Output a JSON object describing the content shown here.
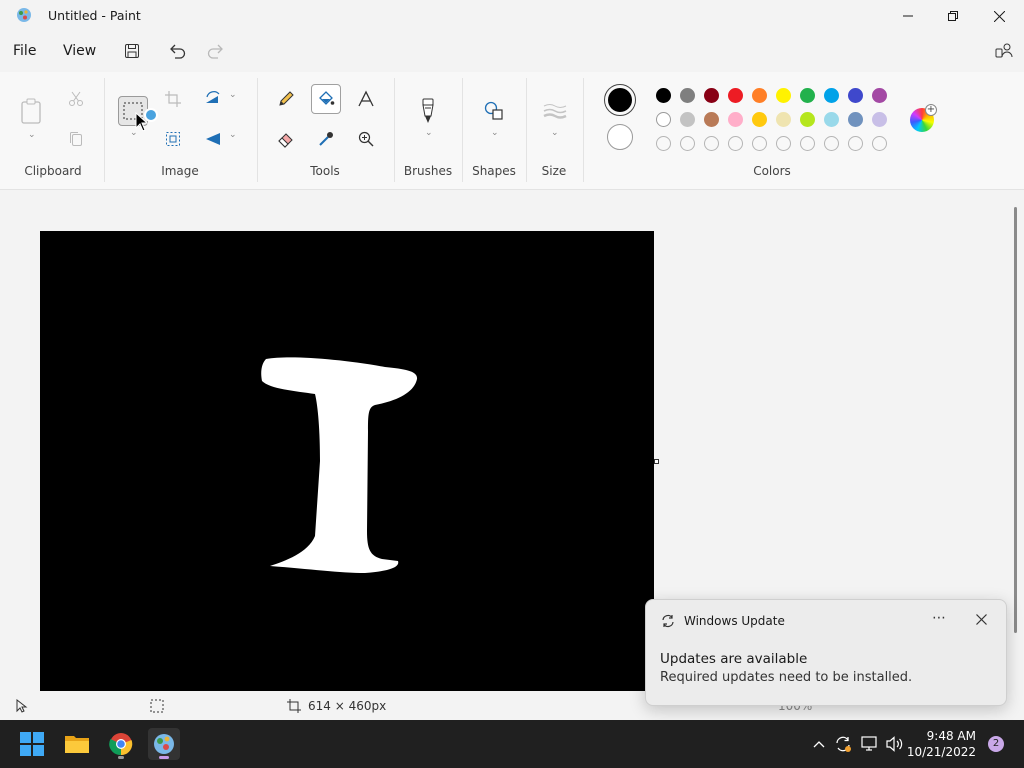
{
  "window": {
    "title": "Untitled - Paint"
  },
  "menu": {
    "file": "File",
    "view": "View"
  },
  "ribbon": {
    "groups": {
      "clipboard": "Clipboard",
      "image": "Image",
      "tools": "Tools",
      "brushes": "Brushes",
      "shapes": "Shapes",
      "size": "Size",
      "colors": "Colors"
    },
    "palette_row1": [
      "#000000",
      "#7f7f7f",
      "#880015",
      "#ed1c24",
      "#ff7f27",
      "#fff200",
      "#22b14c",
      "#00a2e8",
      "#3f48cc",
      "#a349a4"
    ],
    "palette_row2": [
      "#ffffff",
      "#c3c3c3",
      "#b97a57",
      "#ffaec9",
      "#ffc90e",
      "#efe4b0",
      "#b5e61d",
      "#99d9ea",
      "#7092be",
      "#c8bfe7"
    ],
    "palette_row3_empty_count": 10,
    "primary_color": "#000000",
    "secondary_color": "#ffffff"
  },
  "canvas": {
    "background": "#000000",
    "drawing": "white letter I"
  },
  "status": {
    "canvas_size": "614 × 460px",
    "zoom": "100%"
  },
  "notification": {
    "app": "Windows Update",
    "heading": "Updates are available",
    "body": "Required updates need to be installed."
  },
  "taskbar": {
    "time": "9:48 AM",
    "date": "10/21/2022",
    "notification_count": "2"
  }
}
